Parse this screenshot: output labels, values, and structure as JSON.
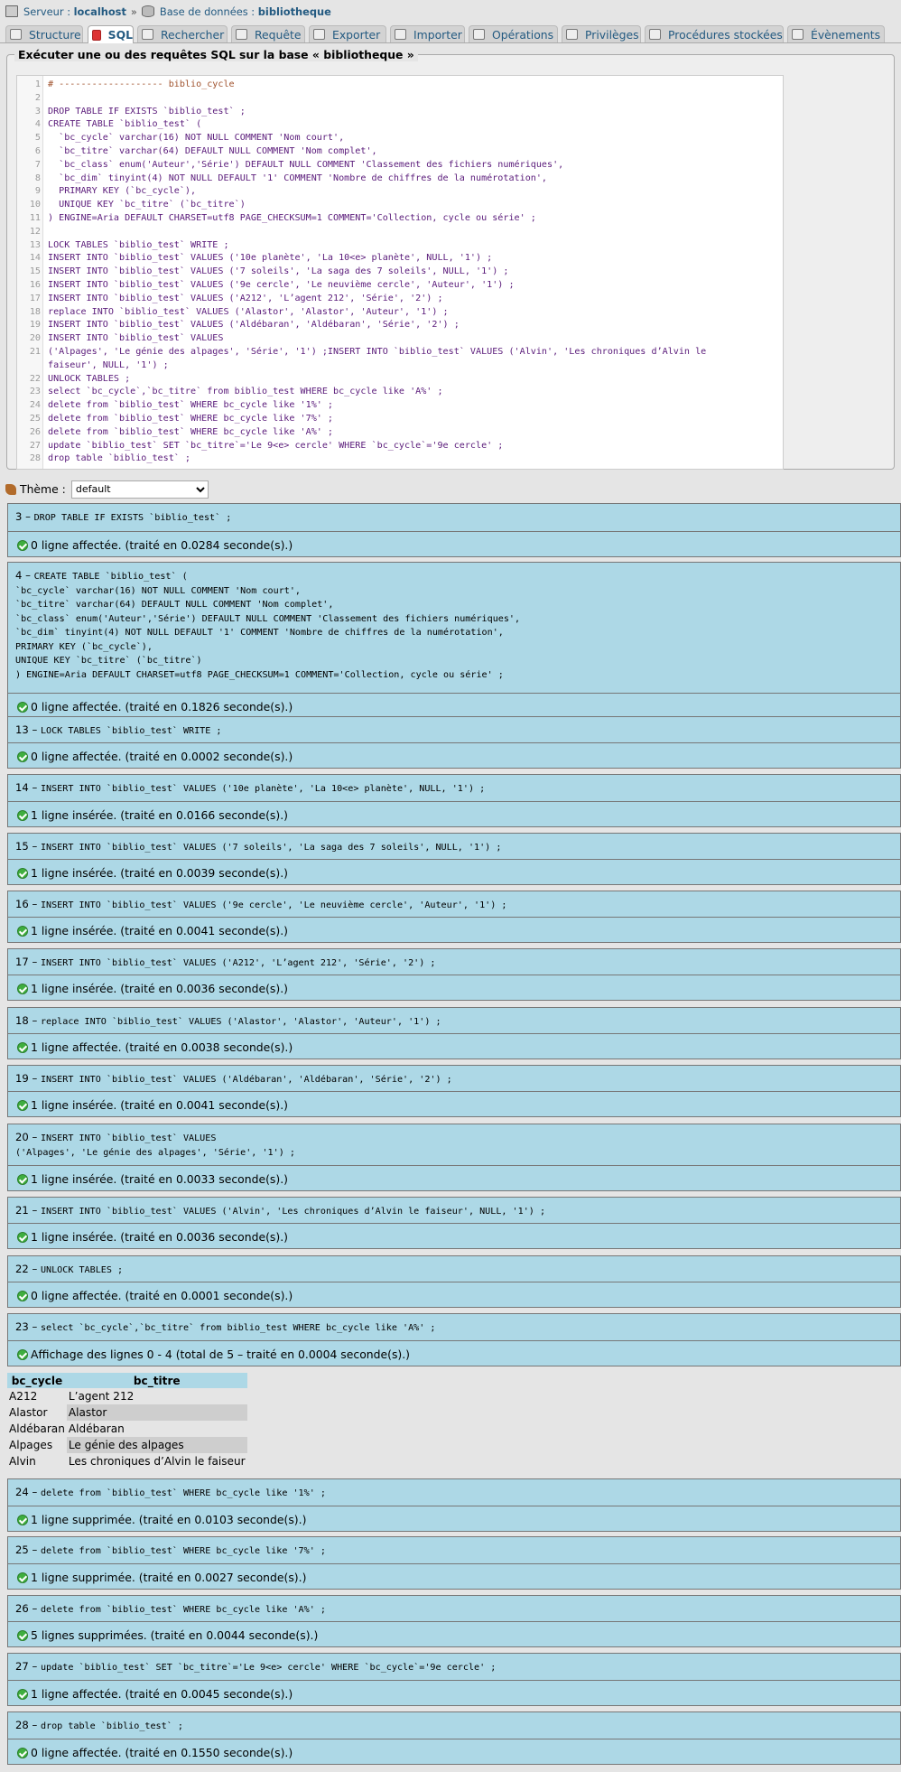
{
  "breadcrumb": {
    "server_label": "Serveur :",
    "server_value": "localhost",
    "db_label": "Base de données :",
    "db_value": "bibliotheque"
  },
  "tabs": [
    {
      "label": "Structure",
      "icon": "structure-icon"
    },
    {
      "label": "SQL",
      "icon": "sql-icon"
    },
    {
      "label": "Rechercher",
      "icon": "search-icon"
    },
    {
      "label": "Requête",
      "icon": "query-icon"
    },
    {
      "label": "Exporter",
      "icon": "export-icon"
    },
    {
      "label": "Importer",
      "icon": "import-icon"
    },
    {
      "label": "Opérations",
      "icon": "operations-icon"
    },
    {
      "label": "Privilèges",
      "icon": "privileges-icon"
    },
    {
      "label": "Procédures stockées",
      "icon": "routines-icon"
    },
    {
      "label": "Évènements",
      "icon": "events-icon"
    }
  ],
  "sql_box": {
    "legend": "Exécuter une ou des requêtes SQL sur la base « bibliotheque »",
    "lines": [
      "# ------------------- biblio_cycle",
      "",
      "DROP TABLE IF EXISTS `biblio_test` ;",
      "CREATE TABLE `biblio_test` (",
      "  `bc_cycle` varchar(16) NOT NULL COMMENT 'Nom court',",
      "  `bc_titre` varchar(64) DEFAULT NULL COMMENT 'Nom complet',",
      "  `bc_class` enum('Auteur','Série') DEFAULT NULL COMMENT 'Classement des fichiers numériques',",
      "  `bc_dim` tinyint(4) NOT NULL DEFAULT '1' COMMENT 'Nombre de chiffres de la numérotation',",
      "  PRIMARY KEY (`bc_cycle`),",
      "  UNIQUE KEY `bc_titre` (`bc_titre`)",
      ") ENGINE=Aria DEFAULT CHARSET=utf8 PAGE_CHECKSUM=1 COMMENT='Collection, cycle ou série' ;",
      "",
      "LOCK TABLES `biblio_test` WRITE ;",
      "INSERT INTO `biblio_test` VALUES ('10e planète', 'La 10<e> planète', NULL, '1') ;",
      "INSERT INTO `biblio_test` VALUES ('7 soleils', 'La saga des 7 soleils', NULL, '1') ;",
      "INSERT INTO `biblio_test` VALUES ('9e cercle', 'Le neuvième cercle', 'Auteur', '1') ;",
      "INSERT INTO `biblio_test` VALUES ('A212', 'L’agent 212', 'Série', '2') ;",
      "replace INTO `biblio_test` VALUES ('Alastor', 'Alastor', 'Auteur', '1') ;",
      "INSERT INTO `biblio_test` VALUES ('Aldébaran', 'Aldébaran', 'Série', '2') ;",
      "INSERT INTO `biblio_test` VALUES",
      "('Alpages', 'Le génie des alpages', 'Série', '1') ;INSERT INTO `biblio_test` VALUES ('Alvin', 'Les chroniques d’Alvin le",
      "faiseur', NULL, '1') ;",
      "UNLOCK TABLES ;",
      "select `bc_cycle`,`bc_titre` from biblio_test WHERE bc_cycle like 'A%' ;",
      "delete from `biblio_test` WHERE bc_cycle like '1%' ;",
      "delete from `biblio_test` WHERE bc_cycle like '7%' ;",
      "delete from `biblio_test` WHERE bc_cycle like 'A%' ;",
      "update `biblio_test` SET `bc_titre`='Le 9<e> cercle' WHERE `bc_cycle`='9e cercle' ;",
      "drop table `biblio_test` ;"
    ],
    "line_numbers": [
      "1",
      "2",
      "3",
      "4",
      "5",
      "6",
      "7",
      "8",
      "9",
      "10",
      "11",
      "12",
      "13",
      "14",
      "15",
      "16",
      "17",
      "18",
      "19",
      "20",
      "21",
      "",
      "22",
      "23",
      "24",
      "25",
      "26",
      "27",
      "28"
    ]
  },
  "theme": {
    "label": "Thème :",
    "value": "default"
  },
  "results": [
    {
      "num": "3",
      "query": "DROP TABLE IF EXISTS `biblio_test` ;",
      "msg": "0 ligne affectée. (traité en 0.0284 seconde(s).)"
    },
    {
      "num": "4",
      "query": "CREATE TABLE `biblio_test` (\n`bc_cycle` varchar(16) NOT NULL COMMENT 'Nom court',\n`bc_titre` varchar(64) DEFAULT NULL COMMENT 'Nom complet',\n`bc_class` enum('Auteur','Série') DEFAULT NULL COMMENT 'Classement des fichiers numériques',\n`bc_dim` tinyint(4) NOT NULL DEFAULT '1' COMMENT 'Nombre de chiffres de la numérotation',\nPRIMARY KEY (`bc_cycle`),\nUNIQUE KEY `bc_titre` (`bc_titre`)\n) ENGINE=Aria DEFAULT CHARSET=utf8 PAGE_CHECKSUM=1 COMMENT='Collection, cycle ou série' ;",
      "msg": "0 ligne affectée. (traité en 0.1826 seconde(s).)"
    },
    {
      "num": "13",
      "query": "LOCK TABLES `biblio_test` WRITE ;",
      "msg": "0 ligne affectée. (traité en 0.0002 seconde(s).)"
    },
    {
      "num": "14",
      "query": "INSERT INTO `biblio_test` VALUES ('10e planète', 'La 10<e> planète', NULL, '1') ;",
      "msg": "1 ligne insérée. (traité en 0.0166 seconde(s).)"
    },
    {
      "num": "15",
      "query": "INSERT INTO `biblio_test` VALUES ('7 soleils', 'La saga des 7 soleils', NULL, '1') ;",
      "msg": "1 ligne insérée. (traité en 0.0039 seconde(s).)"
    },
    {
      "num": "16",
      "query": "INSERT INTO `biblio_test` VALUES ('9e cercle', 'Le neuvième cercle', 'Auteur', '1') ;",
      "msg": "1 ligne insérée. (traité en 0.0041 seconde(s).)"
    },
    {
      "num": "17",
      "query": "INSERT INTO `biblio_test` VALUES ('A212', 'L’agent 212', 'Série', '2') ;",
      "msg": "1 ligne insérée. (traité en 0.0036 seconde(s).)"
    },
    {
      "num": "18",
      "query": "replace INTO `biblio_test` VALUES ('Alastor', 'Alastor', 'Auteur', '1') ;",
      "msg": "1 ligne affectée. (traité en 0.0038 seconde(s).)"
    },
    {
      "num": "19",
      "query": "INSERT INTO `biblio_test` VALUES ('Aldébaran', 'Aldébaran', 'Série', '2') ;",
      "msg": "1 ligne insérée. (traité en 0.0041 seconde(s).)"
    },
    {
      "num": "20",
      "query": "INSERT INTO `biblio_test` VALUES\n('Alpages', 'Le génie des alpages', 'Série', '1') ;",
      "msg": "1 ligne insérée. (traité en 0.0033 seconde(s).)"
    },
    {
      "num": "21",
      "query": "INSERT INTO `biblio_test` VALUES ('Alvin', 'Les chroniques d’Alvin le faiseur', NULL, '1') ;",
      "msg": "1 ligne insérée. (traité en 0.0036 seconde(s).)"
    },
    {
      "num": "22",
      "query": "UNLOCK TABLES ;",
      "msg": "0 ligne affectée. (traité en 0.0001 seconde(s).)"
    },
    {
      "num": "23",
      "query": "select `bc_cycle`,`bc_titre` from biblio_test WHERE bc_cycle like 'A%' ;",
      "msg": "Affichage des lignes 0 - 4 (total de 5 – traité en 0.0004 seconde(s).)"
    },
    {
      "num": "24",
      "query": "delete from `biblio_test` WHERE bc_cycle like '1%' ;",
      "msg": "1 ligne supprimée. (traité en 0.0103 seconde(s).)"
    },
    {
      "num": "25",
      "query": "delete from `biblio_test` WHERE bc_cycle like '7%' ;",
      "msg": "1 ligne supprimée. (traité en 0.0027 seconde(s).)"
    },
    {
      "num": "26",
      "query": "delete from `biblio_test` WHERE bc_cycle like 'A%' ;",
      "msg": "5 lignes supprimées. (traité en 0.0044 seconde(s).)"
    },
    {
      "num": "27",
      "query": "update `biblio_test` SET `bc_titre`='Le 9<e> cercle' WHERE `bc_cycle`='9e cercle' ;",
      "msg": "1 ligne affectée. (traité en 0.0045 seconde(s).)"
    },
    {
      "num": "28",
      "query": "drop table `biblio_test` ;",
      "msg": "0 ligne affectée. (traité en 0.1550 seconde(s).)"
    }
  ],
  "result_table": {
    "headers": [
      "bc_cycle",
      "bc_titre"
    ],
    "rows": [
      [
        "A212",
        "L’agent 212"
      ],
      [
        "Alastor",
        "Alastor"
      ],
      [
        "Aldébaran",
        "Aldébaran"
      ],
      [
        "Alpages",
        "Le génie des alpages"
      ],
      [
        "Alvin",
        "Les chroniques d’Alvin le faiseur"
      ]
    ]
  }
}
